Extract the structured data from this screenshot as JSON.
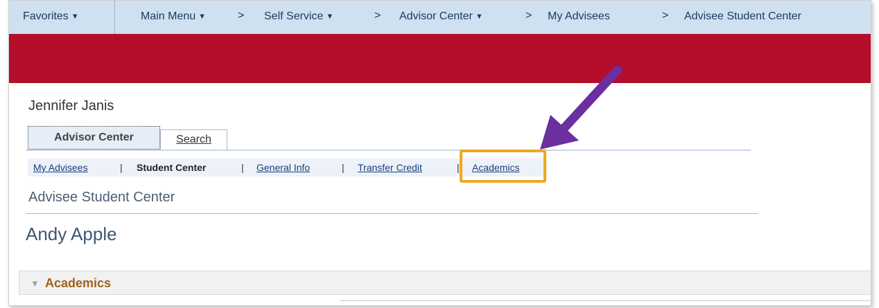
{
  "topnav": {
    "favorites": "Favorites",
    "main_menu": "Main Menu",
    "self_service": "Self Service",
    "advisor_center": "Advisor Center",
    "my_advisees": "My Advisees",
    "advisee_student_center": "Advisee Student Center",
    "separator": ">"
  },
  "user_name": "Jennifer Janis",
  "tabs": [
    {
      "label": "Advisor Center"
    },
    {
      "label": "Search"
    }
  ],
  "subnav": {
    "items": [
      "My Advisees",
      "Student Center",
      "General Info",
      "Transfer Credit",
      "Academics"
    ],
    "separator": "|"
  },
  "page_subtitle": "Advisee Student Center",
  "student_name": "Andy Apple",
  "section": {
    "title": "Academics"
  },
  "colors": {
    "banner": "#b50d2c",
    "nav_bg": "#cfe0f1",
    "highlight": "#f0a820",
    "arrow": "#6b2fa0"
  }
}
